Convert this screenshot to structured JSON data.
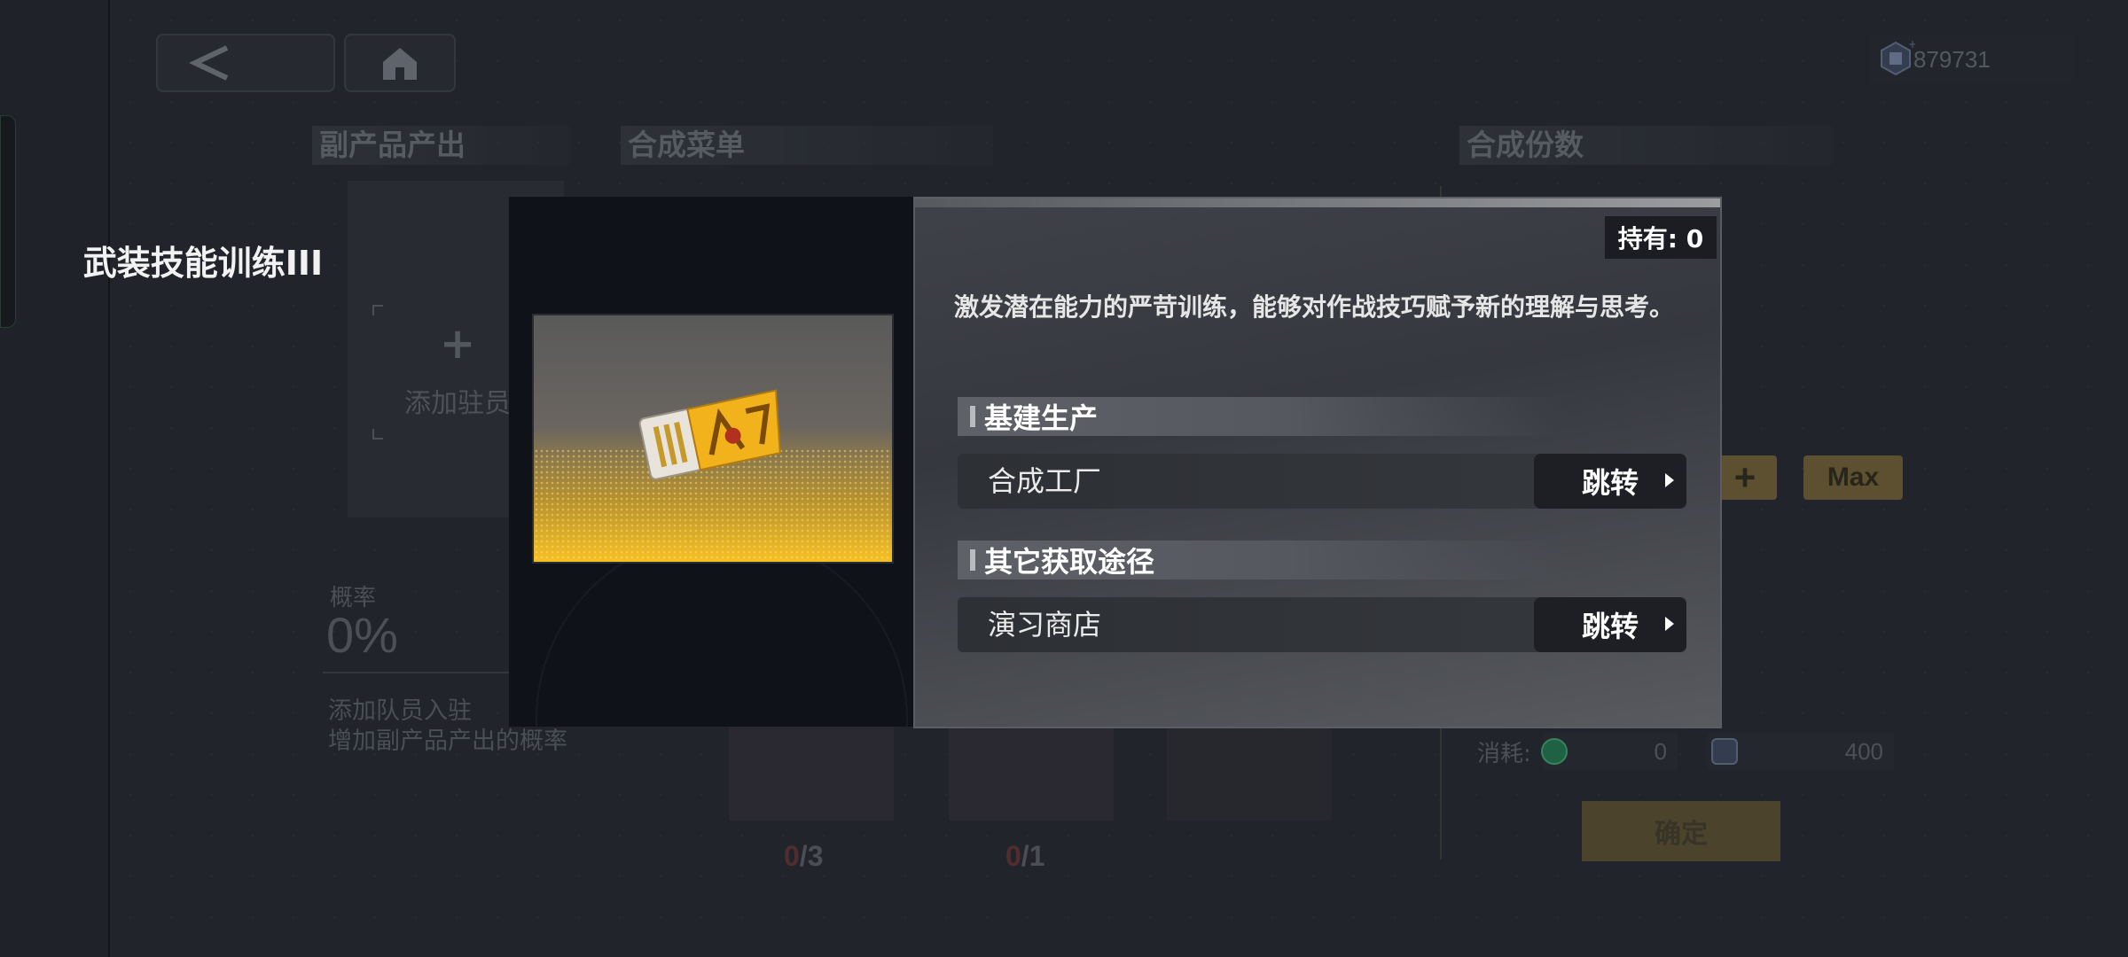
{
  "header": {
    "currency_value": "879731"
  },
  "sections": {
    "byproduct": "副产品产出",
    "menu": "合成菜单",
    "quantity": "合成份数"
  },
  "byproduct_panel": {
    "add_label": "添加驻员",
    "rate_label": "概率",
    "rate_value": "0%",
    "desc_line1": "添加队员入驻",
    "desc_line2": "增加副产品产出的概率"
  },
  "materials": [
    {
      "current": "0",
      "total": "/3"
    },
    {
      "current": "0",
      "total": "/1"
    }
  ],
  "quantity_panel": {
    "plus": "+",
    "max": "Max",
    "consume_label": "消耗:",
    "cost1": "0",
    "cost2": "400",
    "confirm": "确定"
  },
  "modal": {
    "item_name": "武装技能训练III",
    "owned": "持有: 0",
    "description": "激发潜在能力的严苛训练，能够对作战技巧赋予新的理解与思考。",
    "groups": [
      {
        "title": "基建生产",
        "route": "合成工厂",
        "jump": "跳转"
      },
      {
        "title": "其它获取途径",
        "route": "演习商店",
        "jump": "跳转"
      }
    ]
  },
  "colors": {
    "accent_gold": "#f6c024",
    "modal_dark": "#10121a",
    "modal_panel": "#3f4248"
  }
}
